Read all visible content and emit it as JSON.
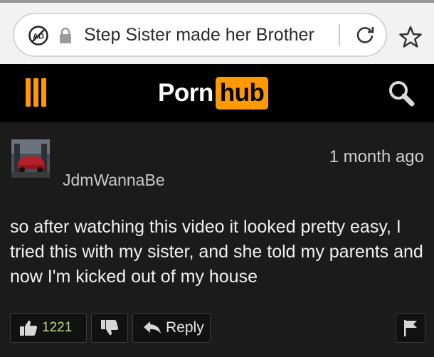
{
  "browser": {
    "url_text": "Step Sister made her Brother",
    "adblock_label": "AD"
  },
  "site": {
    "logo_part1": "Porn",
    "logo_part2": "hub",
    "accent_color": "#ff9900"
  },
  "comment": {
    "username": "JdmWannaBe",
    "timestamp": "1 month ago",
    "text": "so after watching this video it looked pretty easy, I tried this with my sister, and she told my parents and now I'm kicked out of my house",
    "upvotes": "1221",
    "reply_label": "Reply"
  }
}
